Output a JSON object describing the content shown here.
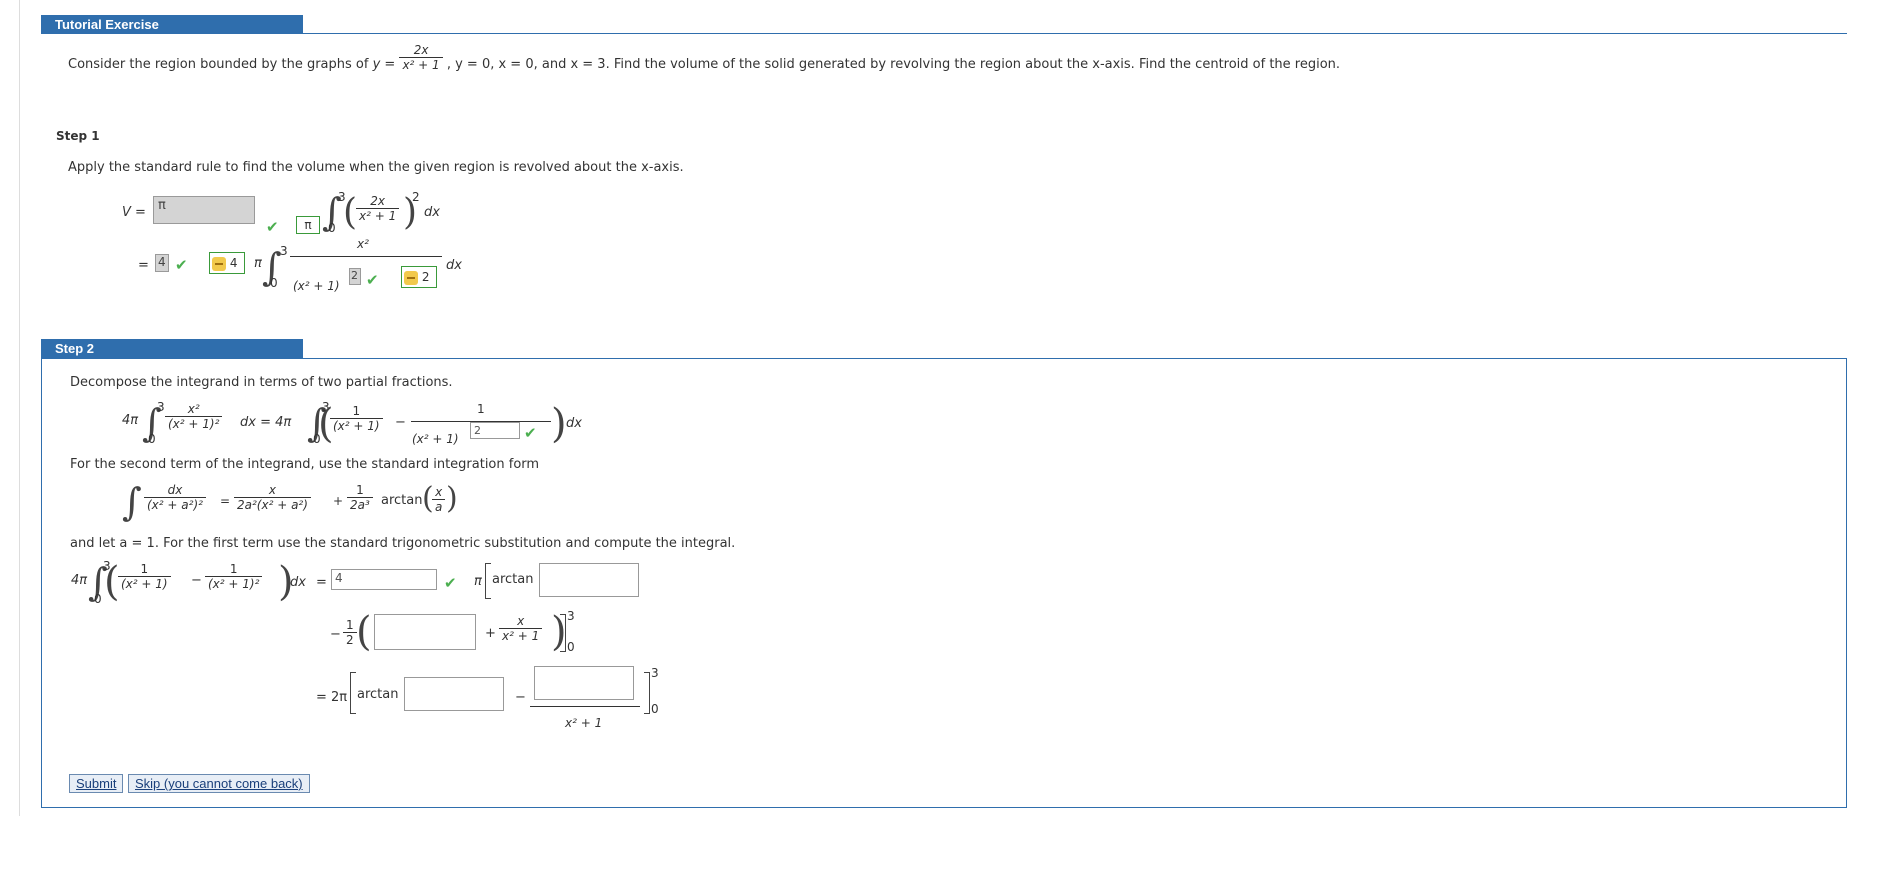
{
  "header": {
    "title": "Tutorial Exercise"
  },
  "problem": {
    "prefix": "Consider the region bounded by the graphs of",
    "y_eq": "y =",
    "num": "2x",
    "den": "x² + 1",
    "suffix": ", y = 0, x = 0, and x = 3. Find the volume of the solid generated by revolving the region about the x-axis. Find the centroid of the region."
  },
  "step1": {
    "title": "Step 1",
    "instruction": "Apply the standard rule to find the volume when the given region is revolved about the x-axis.",
    "v_label": "V =",
    "v_input": "π",
    "pi_box": "π",
    "upper": "3",
    "lower": "0",
    "frac_num": "2x",
    "frac_den": "x² + 1",
    "power": "2",
    "dx": "dx",
    "eq": "=",
    "coef_input": "4",
    "key_val1": "4",
    "pi": "π",
    "num2": "x²",
    "den2": "(x² + 1)",
    "exp_input": "2",
    "key_val2": "2"
  },
  "step2": {
    "title": "Step 2",
    "instruction": "Decompose the integrand in terms of two partial fractions.",
    "lhs_coef": "4π",
    "upper": "3",
    "lower": "0",
    "lhs_num": "x²",
    "lhs_den": "(x² + 1)²",
    "eq_coef": "dx = 4π",
    "t1_num": "1",
    "t1_den": "(x² + 1)",
    "minus": "−",
    "t2_num": "1",
    "t2_den": "(x² + 1)",
    "t2_exp_input": "2",
    "dx": "dx",
    "second_term": "For the second term of the integrand, use the standard integration form",
    "f_num": "dx",
    "f_den": "(x² + a²)²",
    "f_eq": "=",
    "f_r1_num": "x",
    "f_r1_den": "2a²(x² + a²)",
    "f_plus": "+",
    "f_r2_num": "1",
    "f_r2_den": "2a³",
    "f_arctan": "arctan",
    "f_x": "x",
    "f_a": "a",
    "let_a": "and let a = 1. For the first term use the standard trigonometric substitution and compute the integral.",
    "c_coef": "4π",
    "c_t1_num": "1",
    "c_t1_den": "(x² + 1)",
    "c_t2_num": "1",
    "c_t2_den": "(x² + 1)²",
    "c_dx": "dx",
    "c_eq": "=",
    "c_input": "4",
    "c_pi": "π",
    "arctan": "arctan",
    "half_num": "1",
    "half_den": "2",
    "neg": "−",
    "plus": "+",
    "x_num": "x",
    "x_den": "x² + 1",
    "up3": "3",
    "low0": "0",
    "final_eq": "= 2π",
    "final_arctan": "arctan",
    "final_minus": "−",
    "final_den": "x² + 1"
  },
  "buttons": {
    "submit": "Submit",
    "skip": "Skip (you cannot come back)"
  }
}
